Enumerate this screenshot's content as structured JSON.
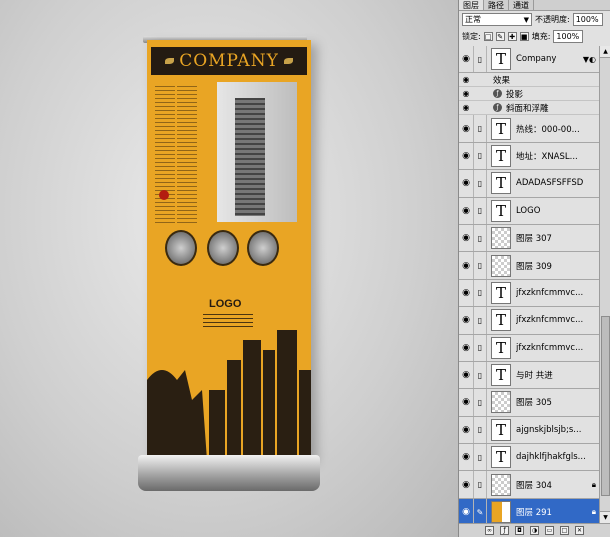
{
  "banner": {
    "company": "COMPANY",
    "logo": "LOGO"
  },
  "panel": {
    "tabs": [
      "图层",
      "路径",
      "通道"
    ],
    "blend_mode": "正常",
    "opacity_label": "不透明度:",
    "opacity_value": "100%",
    "lock_label": "锁定:",
    "fill_label": "填充:",
    "fill_value": "100%",
    "effects_label": "效果",
    "effects": [
      "投影",
      "斜面和浮雕"
    ],
    "layers": [
      {
        "name": "Company",
        "thumb": "text"
      },
      {
        "name": "热线：000-00...",
        "thumb": "text"
      },
      {
        "name": "地址：XNASL...",
        "thumb": "text"
      },
      {
        "name": "ADADASFSFFSD",
        "thumb": "text"
      },
      {
        "name": "LOGO",
        "thumb": "text"
      },
      {
        "name": "图层 307",
        "thumb": "image"
      },
      {
        "name": "图层 309",
        "thumb": "image"
      },
      {
        "name": "jfxzknfcmmvc...",
        "thumb": "text"
      },
      {
        "name": "jfxzknfcmmvc...",
        "thumb": "text"
      },
      {
        "name": "jfxzknfcmmvc...",
        "thumb": "text"
      },
      {
        "name": "与时 共进",
        "thumb": "text"
      },
      {
        "name": "图层 305",
        "thumb": "image"
      },
      {
        "name": "ajgnskjblsjb;s...",
        "thumb": "text"
      },
      {
        "name": "dajhklfjhakfgls...",
        "thumb": "text"
      },
      {
        "name": "图层 304",
        "thumb": "image"
      },
      {
        "name": "图层 291",
        "thumb": "orange"
      }
    ]
  }
}
